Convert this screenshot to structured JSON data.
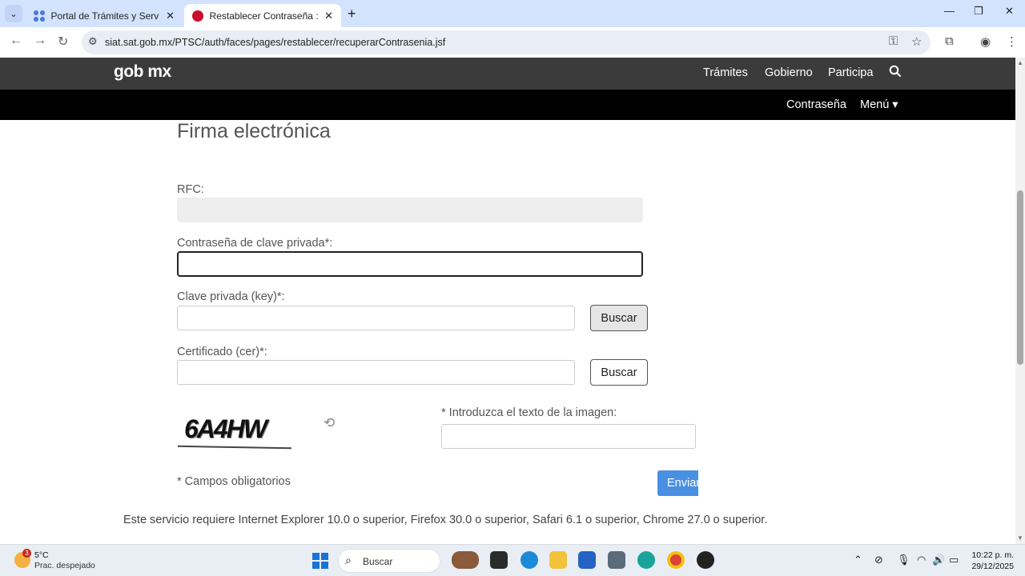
{
  "browser": {
    "tabs": [
      {
        "title": "Portal de Trámites y Servicios de",
        "active": false
      },
      {
        "title": "Restablecer Contraseña :: GobMx",
        "active": true
      }
    ],
    "url": "siat.sat.gob.mx/PTSC/auth/faces/pages/restablecer/recuperarContrasenia.jsf",
    "close_glyph": "✕",
    "newtab_glyph": "+"
  },
  "site": {
    "logo": "gob mx",
    "nav": [
      "Trámites",
      "Gobierno",
      "Participa"
    ],
    "subnav": {
      "contrasena": "Contraseña",
      "menu": "Menú ▾"
    }
  },
  "form": {
    "title": "Firma electrónica",
    "rfc_label": "RFC:",
    "password_label": "Contraseña de clave privada*:",
    "key_label": "Clave privada (key)*:",
    "cert_label": "Certificado (cer)*:",
    "buscar": "Buscar",
    "captcha_text": "6A4HW",
    "captcha_label": "* Introduzca el texto de la imagen:",
    "submit": "Enviar",
    "required_note": "* Campos obligatorios"
  },
  "footnote": "Este servicio requiere Internet Explorer 10.0 o superior, Firefox 30.0 o superior, Safari 6.1 o superior, Chrome 27.0 o superior.",
  "taskbar": {
    "weather_temp": "5°C",
    "weather_cond": "Prac. despejado",
    "weather_badge": "3",
    "search_label": "Buscar",
    "time": "10:22 p. m.",
    "date": "29/12/2025"
  },
  "colors": {
    "gob_bar": "#3b3b3b",
    "accent": "#4a90e2",
    "tabstrip": "#d3e3fd"
  }
}
